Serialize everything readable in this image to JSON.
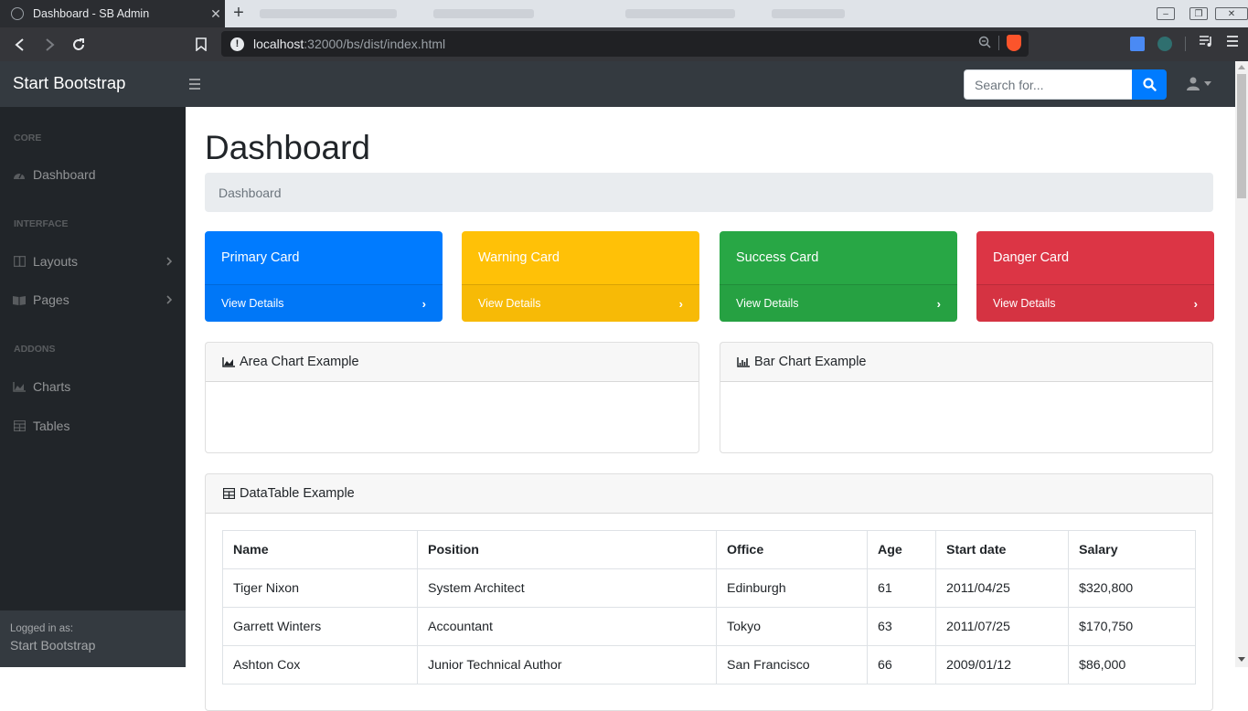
{
  "browser": {
    "tab_title": "Dashboard - SB Admin",
    "url_host": "localhost",
    "url_path": ":32000/bs/dist/index.html"
  },
  "topnav": {
    "brand": "Start Bootstrap",
    "search_placeholder": "Search for..."
  },
  "sidebar": {
    "sections": [
      {
        "heading": "Core",
        "items": [
          {
            "label": "Dashboard",
            "icon": "tachometer-icon"
          }
        ]
      },
      {
        "heading": "Interface",
        "items": [
          {
            "label": "Layouts",
            "icon": "columns-icon"
          },
          {
            "label": "Pages",
            "icon": "book-open-icon"
          }
        ]
      },
      {
        "heading": "Addons",
        "items": [
          {
            "label": "Charts",
            "icon": "area-chart-icon"
          },
          {
            "label": "Tables",
            "icon": "table-icon"
          }
        ]
      }
    ],
    "footer_small": "Logged in as:",
    "footer_name": "Start Bootstrap"
  },
  "main": {
    "title": "Dashboard",
    "breadcrumb": "Dashboard",
    "cards": [
      {
        "title": "Primary Card",
        "link": "View Details",
        "color": "#007bff"
      },
      {
        "title": "Warning Card",
        "link": "View Details",
        "color": "#ffc107"
      },
      {
        "title": "Success Card",
        "link": "View Details",
        "color": "#28a745"
      },
      {
        "title": "Danger Card",
        "link": "View Details",
        "color": "#dc3545"
      }
    ],
    "area_chart_title": "Area Chart Example",
    "bar_chart_title": "Bar Chart Example",
    "datatable_title": "DataTable Example",
    "table": {
      "headers": [
        "Name",
        "Position",
        "Office",
        "Age",
        "Start date",
        "Salary"
      ],
      "rows": [
        [
          "Tiger Nixon",
          "System Architect",
          "Edinburgh",
          "61",
          "2011/04/25",
          "$320,800"
        ],
        [
          "Garrett Winters",
          "Accountant",
          "Tokyo",
          "63",
          "2011/07/25",
          "$170,750"
        ],
        [
          "Ashton Cox",
          "Junior Technical Author",
          "San Francisco",
          "66",
          "2009/01/12",
          "$86,000"
        ]
      ]
    }
  }
}
